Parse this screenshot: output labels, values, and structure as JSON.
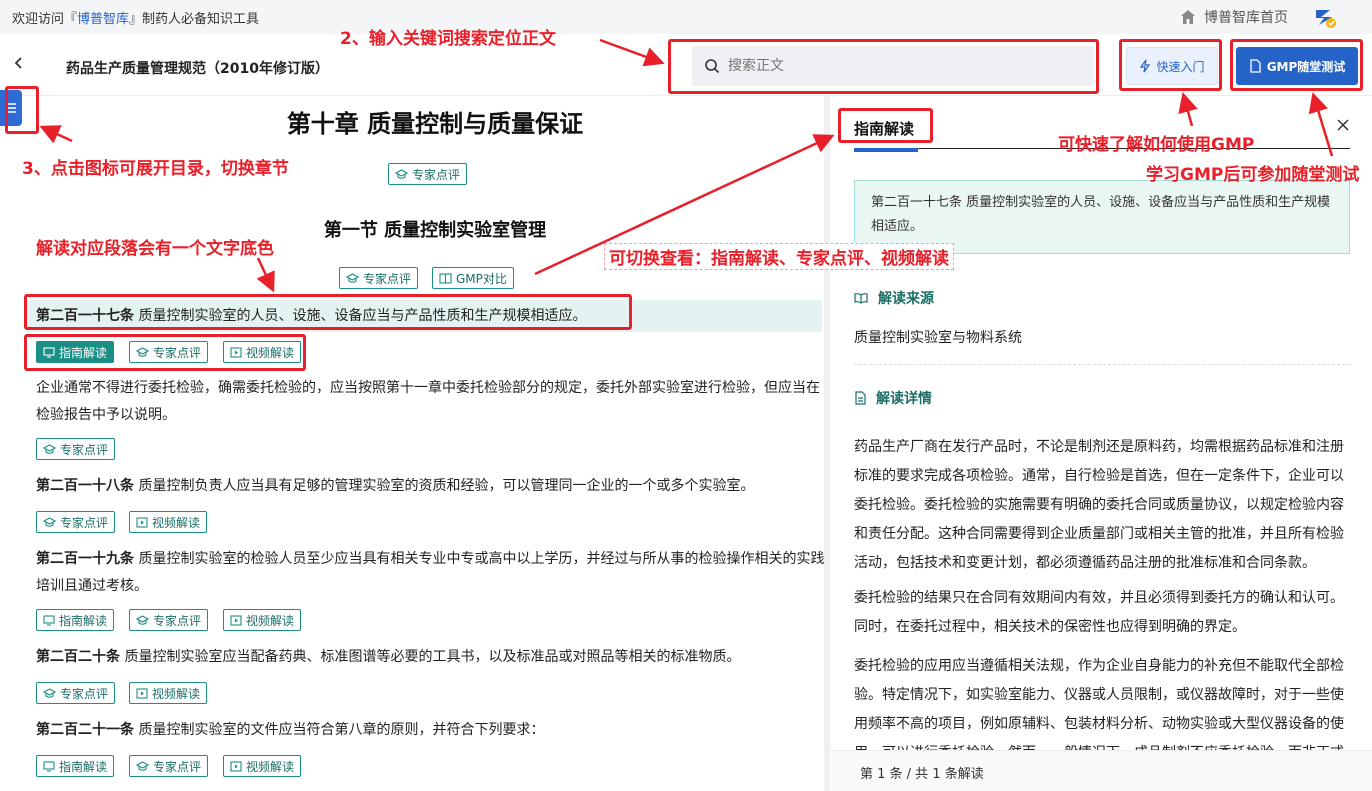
{
  "topbar": {
    "welcome_prefix": "欢迎访问『",
    "brand": "博普智库",
    "welcome_suffix": "』制药人必备知识工具",
    "home_label": "博普智库首页"
  },
  "header": {
    "doc_title": "药品生产质量管理规范（2010年修订版）",
    "search_placeholder": "搜索正文",
    "quick_start_label": "快速入门",
    "test_label": "GMP随堂测试"
  },
  "main": {
    "chapter_title": "第十章  质量控制与质量保证",
    "chapter_tag": "专家点评",
    "section_title": "第一节  质量控制实验室管理",
    "section_tags": [
      "专家点评",
      "GMP对比"
    ],
    "articles": [
      {
        "num": "第二百一十七条",
        "text": "质量控制实验室的人员、设施、设备应当与产品性质和生产规模相适应。",
        "tags": [
          "指南解读",
          "专家点评",
          "视频解读"
        ]
      },
      {
        "num": "",
        "text": "企业通常不得进行委托检验，确需委托检验的，应当按照第十一章中委托检验部分的规定，委托外部实验室进行检验，但应当在检验报告中予以说明。",
        "tags": [
          "专家点评"
        ]
      },
      {
        "num": "第二百一十八条",
        "text": "质量控制负责人应当具有足够的管理实验室的资质和经验，可以管理同一企业的一个或多个实验室。",
        "tags": [
          "专家点评",
          "视频解读"
        ]
      },
      {
        "num": "第二百一十九条",
        "text": "质量控制实验室的检验人员至少应当具有相关专业中专或高中以上学历，并经过与所从事的检验操作相关的实践培训且通过考核。",
        "tags": [
          "指南解读",
          "专家点评",
          "视频解读"
        ]
      },
      {
        "num": "第二百二十条",
        "text": "质量控制实验室应当配备药典、标准图谱等必要的工具书，以及标准品或对照品等相关的标准物质。",
        "tags": [
          "专家点评",
          "视频解读"
        ]
      },
      {
        "num": "第二百二十一条",
        "text": "质量控制实验室的文件应当符合第八章的原则，并符合下列要求：",
        "tags": [
          "指南解读",
          "专家点评",
          "视频解读"
        ]
      }
    ]
  },
  "panel": {
    "tab": "指南解读",
    "quote": "第二百一十七条 质量控制实验室的人员、设施、设备应当与产品性质和生产规模相适应。",
    "source_heading": "解读来源",
    "source_text": "质量控制实验室与物料系统",
    "detail_heading": "解读详情",
    "detail_paragraphs": [
      "药品生产厂商在发行产品时，不论是制剂还是原料药，均需根据药品标准和注册标准的要求完成各项检验。通常，自行检验是首选，但在一定条件下，企业可以委托检验。委托检验的实施需要有明确的委托合同或质量协议，以规定检验内容和责任分配。这种合同需要得到企业质量部门或相关主管的批准，并且所有检验活动，包括技术和变更计划，都必须遵循药品注册的批准标准和合同条款。",
      "委托检验的结果只在合同有效期间内有效，并且必须得到委托方的确认和认可。同时，在委托过程中，相关技术的保密性也应得到明确的界定。",
      "委托检验的应用应当遵循相关法规，作为企业自身能力的补充但不能取代全部检验。特定情况下，如实验室能力、仪器或人员限制，或仪器故障时，对于一些使用频率不高的项目，例如原辅料、包装材料分析、动物实验或大型仪器设备的使用，可以进行委托检验。然而，一般情况下，成品制剂不应委托检验，而非正式"
    ],
    "footer": "第 1 条 / 共 1 条解读"
  },
  "annotations": {
    "search_note": "2、输入关键词搜索定位正文",
    "toc_note": "3、点击图标可展开目录，切换章节",
    "highlight_note": "解读对应段落会有一个文字底色",
    "switch_note": "可切换查看：指南解读、专家点评、视频解读",
    "quick_note": "可快速了解如何使用GMP",
    "test_note": "学习GMP后可参加随堂测试"
  },
  "colors": {
    "accent": "#2563c9",
    "teal": "#1b8f84",
    "annotation": "#e8202a"
  }
}
